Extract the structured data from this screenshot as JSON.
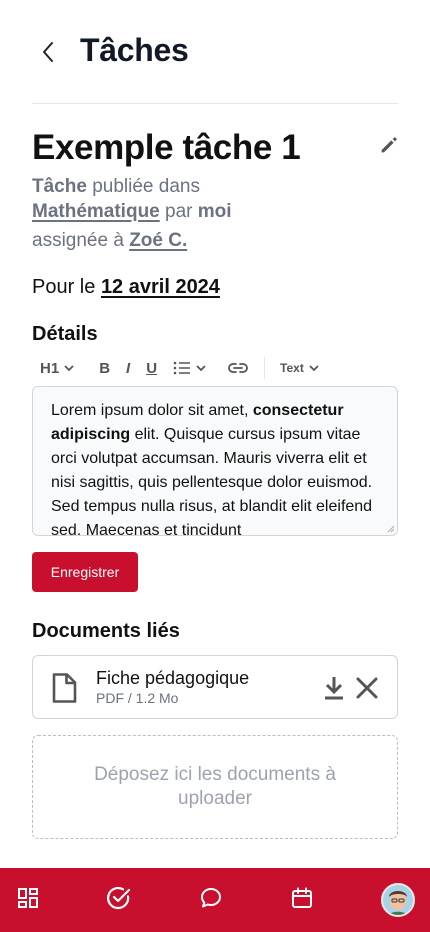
{
  "header": {
    "title": "Tâches",
    "back_icon": "chevron-left-icon"
  },
  "task": {
    "title": "Exemple tâche 1",
    "edit_icon": "pencil-icon",
    "meta": {
      "type_label": "Tâche",
      "published_in_text": "publiée dans",
      "subject": "Mathématique",
      "by_text": "par",
      "author": "moi",
      "assigned_text": "assignée à",
      "assignee": "Zoé C."
    },
    "due": {
      "prefix": "Pour le",
      "date": "12 avril 2024"
    }
  },
  "details": {
    "label": "Détails",
    "toolbar": {
      "heading": "H1",
      "bold": "B",
      "italic": "I",
      "underline": "U",
      "list_icon": "bullet-list-icon",
      "link_icon": "link-icon",
      "text_style": "Text"
    },
    "content": {
      "part1": "Lorem ipsum dolor sit amet, ",
      "bold_part": "consectetur adipiscing",
      "part2": " elit. Quisque cursus ipsum vitae orci volutpat accumsan. Mauris viverra elit et nisi sagittis, quis pellentesque dolor euismod. Sed tempus nulla risus, at blandit elit eleifend sed. Maecenas et tincidunt"
    },
    "save_label": "Enregistrer"
  },
  "documents": {
    "label": "Documents liés",
    "items": [
      {
        "name": "Fiche pédagogique",
        "meta": "PDF / 1.2 Mo",
        "icon": "file-icon"
      }
    ],
    "dropzone_text": "Déposez ici les documents à uploader"
  },
  "bottom_nav": {
    "items": [
      "dashboard-icon",
      "tasks-check-icon",
      "chat-icon",
      "calendar-icon",
      "profile-avatar"
    ]
  },
  "colors": {
    "accent": "#c8102e",
    "muted_text": "#6b7280",
    "border": "#d1d5db"
  }
}
